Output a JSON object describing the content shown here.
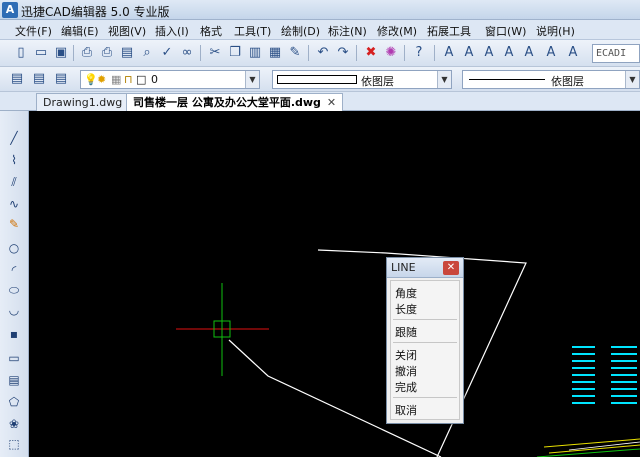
{
  "app": {
    "icon_text": "A",
    "title": "迅捷CAD编辑器 5.0 专业版"
  },
  "menu": [
    "文件(F)",
    "编辑(E)",
    "视图(V)",
    "插入(I)",
    "格式",
    "工具(T)",
    "绘制(D)",
    "标注(N)",
    "修改(M)",
    "拓展工具",
    "窗口(W)",
    "说明(H)"
  ],
  "toolbar": {
    "text_style_value": "ECADI"
  },
  "layer_bar": {
    "layer_value": "0",
    "color_value": "依图层",
    "linetype_value": "依图层"
  },
  "tabs": [
    {
      "label": "Drawing1.dwg",
      "active": false
    },
    {
      "label": "司售楼一层 公寓及办公大堂平面.dwg",
      "active": true,
      "close": "✕"
    }
  ],
  "context_menu": {
    "title": "LINE",
    "close_glyph": "✕",
    "groups": [
      [
        "角度",
        "长度"
      ],
      [
        "跟随"
      ],
      [
        "关闭",
        "撤消",
        "完成"
      ],
      [
        "取消"
      ]
    ]
  },
  "colors": {
    "canvas_bg": "#000000",
    "crosshair": "#e01010",
    "crosshair_vertical": "#10c010",
    "drawing_line": "#ffffff",
    "cyan_text": "#00e5ff",
    "yellow_line": "#e8e000"
  },
  "icons": {
    "toolbar": [
      "new-file-icon",
      "open-icon",
      "save-icon",
      "print-icon",
      "print-preview-icon",
      "page-setup-icon",
      "find-icon",
      "spell-check-icon",
      "binoculars-icon",
      "cut-icon",
      "copy-icon",
      "paste-icon",
      "paste-special-icon",
      "match-properties-icon",
      "undo-icon",
      "redo-icon",
      "delete-icon",
      "purge-icon",
      "help-icon",
      "text-style-icon",
      "text-icon",
      "text-edit-icon",
      "text-scale-icon",
      "text-find-icon"
    ],
    "left_tools": [
      "line-tool-icon",
      "polyline-tool-icon",
      "multiline-tool-icon",
      "spline-tool-icon",
      "freehand-tool-icon",
      "circle-tool-icon",
      "arc-tool-icon",
      "ellipse-tool-icon",
      "ellipse-arc-tool-icon",
      "point-tool-icon",
      "rectangle-tool-icon",
      "hatch-tool-icon",
      "polygon-tool-icon",
      "cloud-tool-icon"
    ]
  }
}
